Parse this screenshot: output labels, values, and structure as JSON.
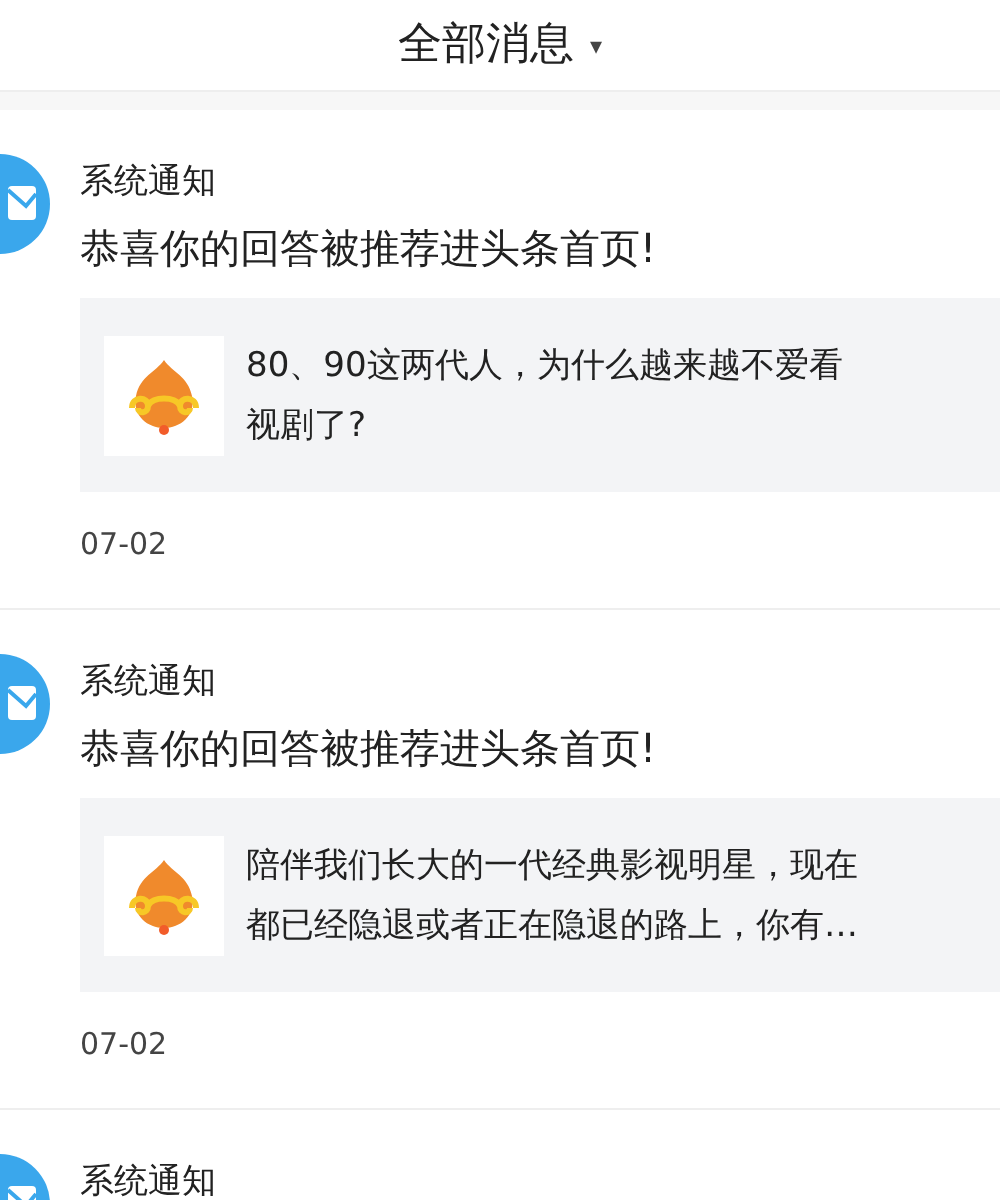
{
  "header": {
    "title": "全部消息",
    "dropdown_caret": "▾"
  },
  "notifications": [
    {
      "sender": "系统通知",
      "message": "恭喜你的回答被推荐进头条首页!",
      "snippet": [
        "80、90这两代人，为什么越来越不爱看",
        "视剧了?"
      ],
      "date": "07-02"
    },
    {
      "sender": "系统通知",
      "message": "恭喜你的回答被推荐进头条首页!",
      "snippet": [
        "陪伴我们长大的一代经典影视明星，现在",
        "都已经隐退或者正在隐退的路上，你有…"
      ],
      "date": "07-02"
    },
    {
      "sender": "系统通知"
    }
  ]
}
